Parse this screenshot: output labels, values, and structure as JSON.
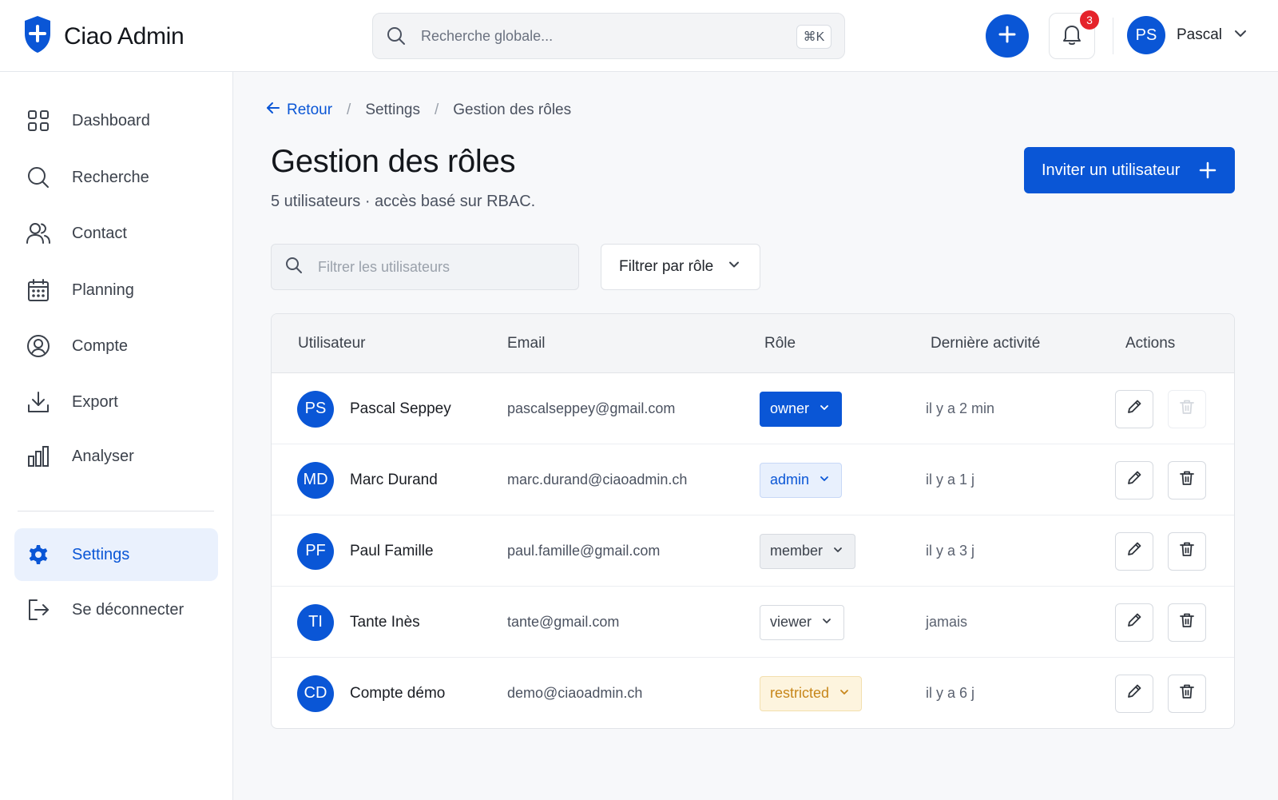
{
  "app": {
    "name": "Ciao Admin"
  },
  "topbar": {
    "search_placeholder": "Recherche globale...",
    "shortcut": "⌘K",
    "notification_count": "3",
    "user_initials": "PS",
    "user_name": "Pascal"
  },
  "sidebar": {
    "items": [
      {
        "label": "Dashboard",
        "icon": "grid-icon"
      },
      {
        "label": "Recherche",
        "icon": "search-icon"
      },
      {
        "label": "Contact",
        "icon": "users-icon"
      },
      {
        "label": "Planning",
        "icon": "calendar-icon"
      },
      {
        "label": "Compte",
        "icon": "user-circle-icon"
      },
      {
        "label": "Export",
        "icon": "download-icon"
      },
      {
        "label": "Analyser",
        "icon": "bar-chart-icon"
      }
    ],
    "settings": {
      "label": "Settings",
      "icon": "gear-icon",
      "active": true
    },
    "logout": {
      "label": "Se déconnecter",
      "icon": "logout-icon"
    }
  },
  "breadcrumb": {
    "back": "Retour",
    "items": [
      "Settings",
      "Gestion des rôles"
    ]
  },
  "page": {
    "title": "Gestion des rôles",
    "subtitle": "5 utilisateurs · accès basé sur RBAC.",
    "invite_label": "Inviter un utilisateur",
    "filter_placeholder": "Filtrer les utilisateurs",
    "role_filter_label": "Filtrer par rôle"
  },
  "colors": {
    "accent": "#0a56d6",
    "badge": "#e5232b",
    "restricted": "#c7861a"
  },
  "table": {
    "columns": [
      "Utilisateur",
      "Email",
      "Rôle",
      "Dernière activité",
      "Actions"
    ],
    "rows": [
      {
        "initials": "PS",
        "name": "Pascal Seppey",
        "email": "pascalseppey@gmail.com",
        "role": "owner",
        "activity": "il y a 2 min",
        "delete_disabled": true
      },
      {
        "initials": "MD",
        "name": "Marc Durand",
        "email": "marc.durand@ciaoadmin.ch",
        "role": "admin",
        "activity": "il y a 1 j",
        "delete_disabled": false
      },
      {
        "initials": "PF",
        "name": "Paul Famille",
        "email": "paul.famille@gmail.com",
        "role": "member",
        "activity": "il y a 3 j",
        "delete_disabled": false
      },
      {
        "initials": "TI",
        "name": "Tante Inès",
        "email": "tante@gmail.com",
        "role": "viewer",
        "activity": "jamais",
        "delete_disabled": false
      },
      {
        "initials": "CD",
        "name": "Compte démo",
        "email": "demo@ciaoadmin.ch",
        "role": "restricted",
        "activity": "il y a 6 j",
        "delete_disabled": false
      }
    ]
  }
}
